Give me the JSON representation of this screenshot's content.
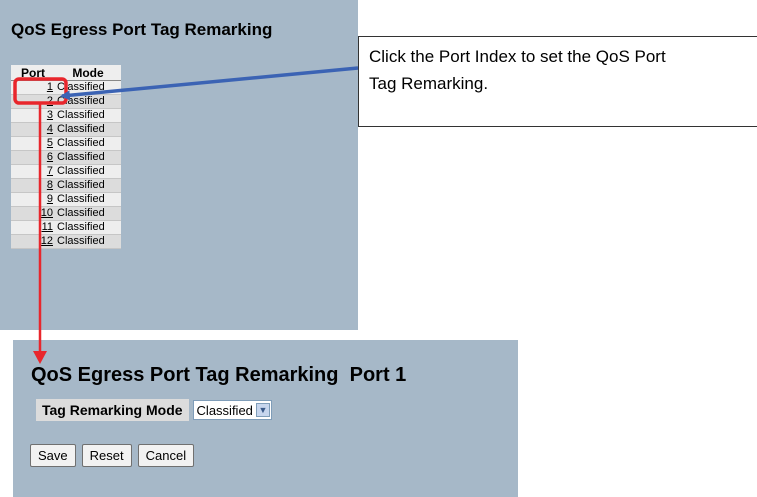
{
  "top_panel": {
    "title": "QoS Egress Port Tag Remarking",
    "columns": {
      "port": "Port",
      "mode": "Mode"
    },
    "rows": [
      {
        "port": "1",
        "mode": "Classified"
      },
      {
        "port": "2",
        "mode": "Classified"
      },
      {
        "port": "3",
        "mode": "Classified"
      },
      {
        "port": "4",
        "mode": "Classified"
      },
      {
        "port": "5",
        "mode": "Classified"
      },
      {
        "port": "6",
        "mode": "Classified"
      },
      {
        "port": "7",
        "mode": "Classified"
      },
      {
        "port": "8",
        "mode": "Classified"
      },
      {
        "port": "9",
        "mode": "Classified"
      },
      {
        "port": "10",
        "mode": "Classified"
      },
      {
        "port": "11",
        "mode": "Classified"
      },
      {
        "port": "12",
        "mode": "Classified"
      }
    ]
  },
  "callout": {
    "line1": "Click the Port Index to set the QoS Port",
    "line2": "Tag Remarking."
  },
  "bottom_panel": {
    "title": "QoS Egress Port Tag Remarking  Port 1",
    "mode_label": "Tag Remarking Mode",
    "mode_value": "Classified",
    "buttons": {
      "save": "Save",
      "reset": "Reset",
      "cancel": "Cancel"
    }
  },
  "colors": {
    "panel_bg": "#a6b8c8",
    "highlight_red": "#e8262c",
    "arrow_blue": "#3b63b4"
  }
}
